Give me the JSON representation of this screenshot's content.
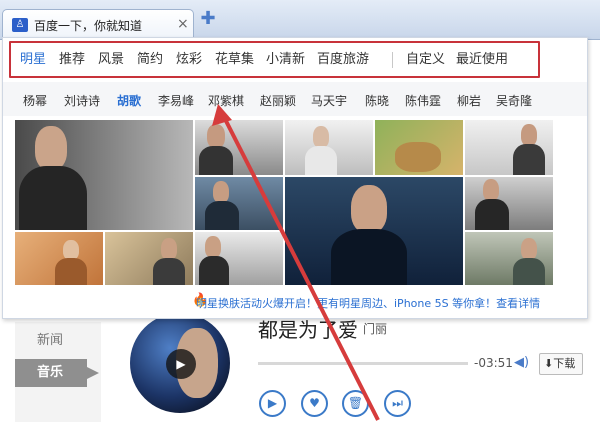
{
  "browser": {
    "tab_title": "百度一下，你就知道",
    "close_glyph": "×",
    "newtab_glyph": "✚",
    "favicon_glyph": "♙",
    "favicon_icon": "paw-icon"
  },
  "skin_panel": {
    "categories": [
      "明星",
      "推荐",
      "风景",
      "简约",
      "炫彩",
      "花草集",
      "小清新",
      "百度旅游",
      "自定义",
      "最近使用"
    ],
    "active_category": "明星",
    "names": [
      "杨幂",
      "刘诗诗",
      "胡歌",
      "李易峰",
      "邓紫棋",
      "赵丽颖",
      "马天宇",
      "陈晓",
      "陈伟霆",
      "柳岩",
      "吴奇隆"
    ],
    "active_name": "胡歌",
    "promo_text": "明星换肤活动火爆开启！更有明星周边、iPhone 5S 等你拿！查看详情"
  },
  "sidebar": {
    "items": [
      "新闻",
      "音乐"
    ],
    "active": "音乐"
  },
  "player": {
    "song_title": "都是为了爱",
    "artist": "门丽",
    "time": "-03:51",
    "download_label": "下载",
    "download_glyph": "⬇",
    "volume_glyph": "◀)",
    "play_glyph": "▶",
    "controls": [
      "▶",
      "♥",
      "🗑",
      "⏭"
    ]
  },
  "colors": {
    "accent": "#2a6fd2",
    "highlight_box": "#c8323a",
    "arrow": "#d63c3c"
  }
}
